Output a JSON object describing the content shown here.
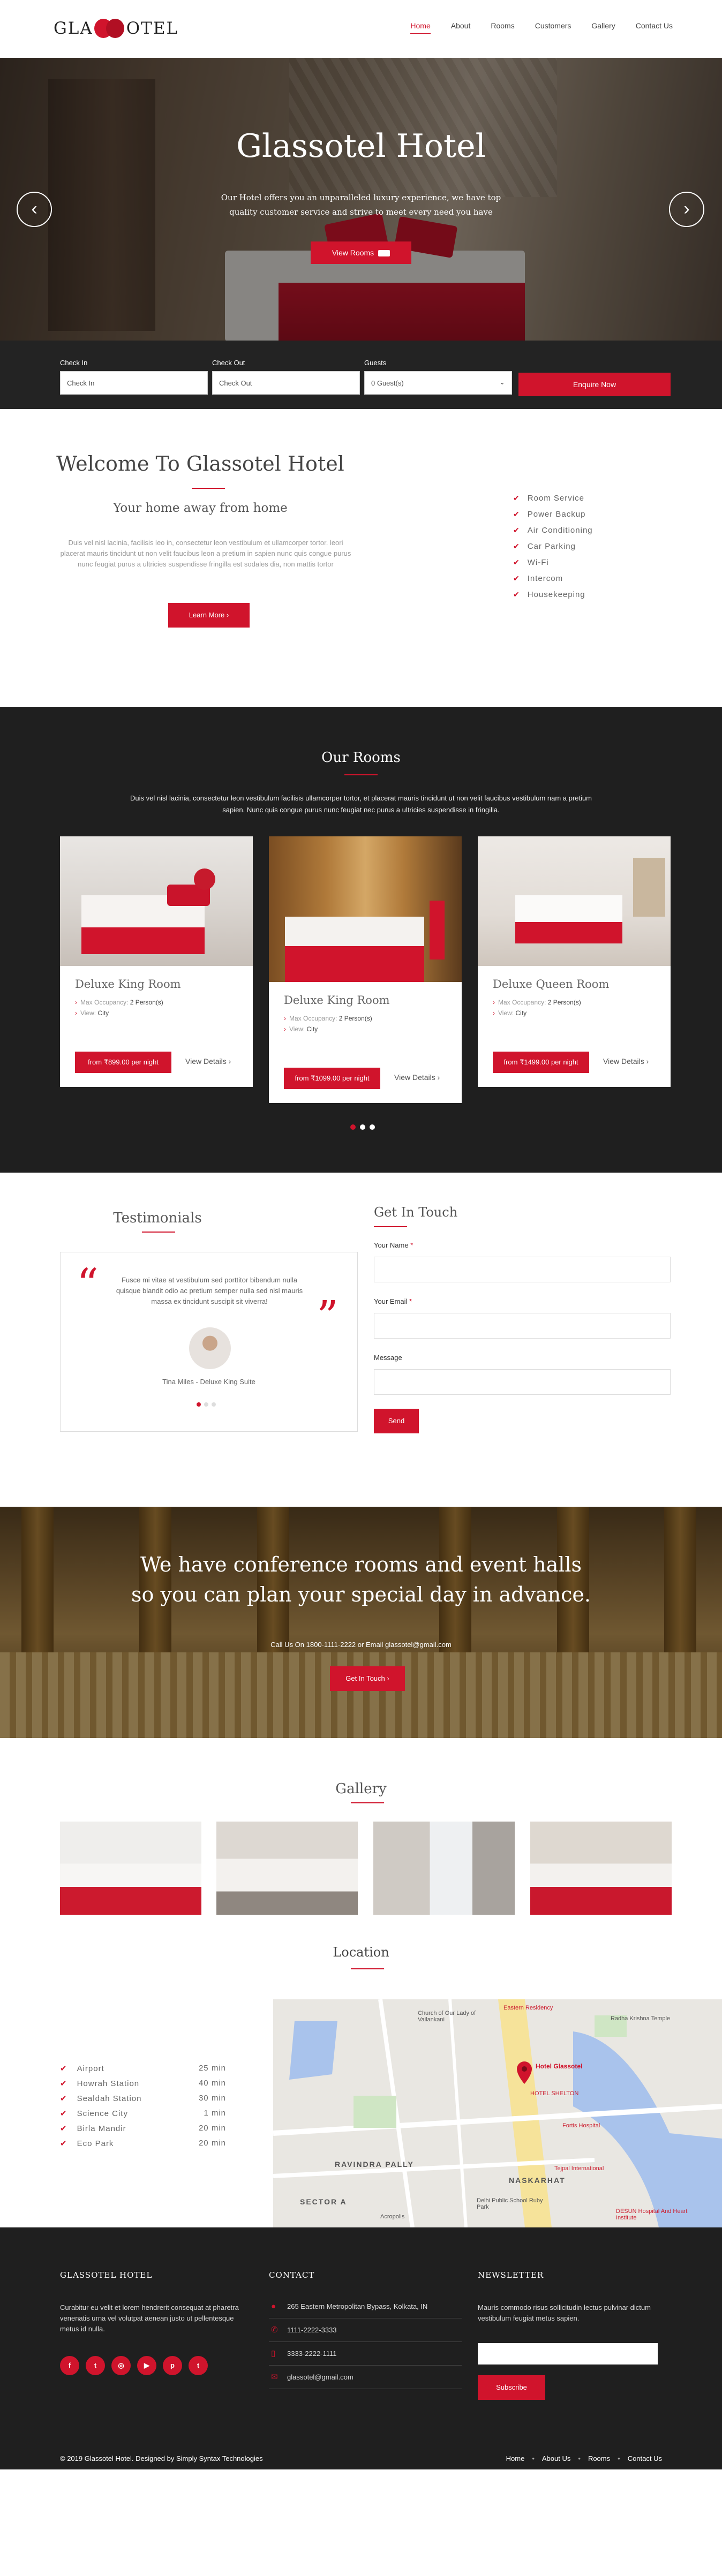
{
  "brand": {
    "logo_text_left": "GLA",
    "logo_text_right": "OTEL"
  },
  "nav": {
    "items": [
      "Home",
      "About",
      "Rooms",
      "Customers",
      "Gallery",
      "Contact Us"
    ],
    "active": "Home"
  },
  "hero": {
    "title": "Glassotel Hotel",
    "text": "Our Hotel offers you an unparalleled luxury experience, we have top quality customer service and strive to meet every need you have",
    "button": "View Rooms",
    "prev": "‹",
    "next": "›"
  },
  "booking": {
    "checkin_label": "Check In",
    "checkin_placeholder": "Check In",
    "checkout_label": "Check Out",
    "checkout_placeholder": "Check Out",
    "guests_label": "Guests",
    "guests_value": "0 Guest(s)",
    "button": "Enquire Now"
  },
  "welcome": {
    "title": "Welcome To Glassotel Hotel",
    "subtitle": "Your home away from home",
    "text": "Duis vel nisl lacinia, facilisis leo in, consectetur leon vestibulum et ullamcorper tortor. leori placerat mauris tincidunt ut non velit faucibus leon a pretium in sapien nunc quis congue purus nunc feugiat purus a ultricies suspendisse fringilla est sodales dia, non mattis tortor",
    "button": "Learn More",
    "amenities": [
      "Room Service",
      "Power Backup",
      "Air Conditioning",
      "Car Parking",
      "Wi-Fi",
      "Intercom",
      "Housekeeping"
    ]
  },
  "rooms": {
    "title": "Our Rooms",
    "text": "Duis vel nisl lacinia, consectetur leon vestibulum facilisis ullamcorper tortor, et placerat mauris tincidunt ut non velit faucibus vestibulum nam a pretium sapien. Nunc quis congue purus nunc feugiat nec purus a ultricies suspendisse in fringilla.",
    "occupancy_label": "Max Occupancy:",
    "view_label": "View:",
    "details_label": "View Details",
    "items": [
      {
        "name": "Deluxe King Room",
        "occupancy": "2 Person(s)",
        "view": "City",
        "price": "from ₹899.00 per night"
      },
      {
        "name": "Deluxe King Room",
        "occupancy": "2 Person(s)",
        "view": "City",
        "price": "from ₹1099.00 per night"
      },
      {
        "name": "Deluxe Queen Room",
        "occupancy": "2 Person(s)",
        "view": "City",
        "price": "from ₹1499.00 per night"
      }
    ]
  },
  "testimonials": {
    "title": "Testimonials",
    "quote": "Fusce mi vitae at vestibulum sed porttitor bibendum nulla quisque blandit odio ac pretium semper nulla sed nisl mauris massa ex tincidunt suscipit sit viverra!",
    "author": "Tina Miles - Deluxe King Suite"
  },
  "contact_form": {
    "title": "Get In Touch",
    "name_label": "Your Name",
    "email_label": "Your Email",
    "message_label": "Message",
    "required_mark": "*",
    "button": "Send"
  },
  "events": {
    "title": "We have conference rooms and event halls so you can plan your special day in advance.",
    "call_text": "Call Us On 1800-1111-2222 or Email glassotel@gmail.com",
    "button": "Get In Touch"
  },
  "gallery": {
    "title": "Gallery"
  },
  "location": {
    "title": "Location",
    "places": [
      {
        "name": "Airport",
        "time": "25 min"
      },
      {
        "name": "Howrah Station",
        "time": "40 min"
      },
      {
        "name": "Sealdah Station",
        "time": "30 min"
      },
      {
        "name": "Science City",
        "time": "1 min"
      },
      {
        "name": "Birla Mandir",
        "time": "20 min"
      },
      {
        "name": "Eco Park",
        "time": "20 min"
      }
    ],
    "map_labels": {
      "pin": "Hotel Glassotel",
      "residency": "Eastern Residency",
      "church": "Church of Our Lady of Vailankani",
      "radha": "Radha Krishna Temple",
      "shelton": "HOTEL SHELTON",
      "fortis": "Fortis Hospital",
      "area1": "RAVINDRA PALLY",
      "area2": "NASKARHAT",
      "area3": "SECTOR A",
      "school": "Delhi Public School Ruby Park",
      "acropolis": "Acropolis",
      "desun": "DESUN Hospital And Heart Institute",
      "intl": "Tejpal International"
    }
  },
  "footer": {
    "about_title": "GLASSOTEL HOTEL",
    "about_text": "Curabitur eu velit et lorem hendrerit consequat at pharetra venenatis urna vel volutpat aenean justo ut pellentesque metus id nulla.",
    "social": [
      "f",
      "t",
      "◎",
      "▶",
      "p",
      "t"
    ],
    "contact_title": "CONTACT",
    "address": "265 Eastern Metropolitan Bypass, Kolkata, IN",
    "phone1": "1111-2222-3333",
    "phone2": "3333-2222-1111",
    "email": "glassotel@gmail.com",
    "newsletter_title": "NEWSLETTER",
    "newsletter_text": "Mauris commodo risus sollicitudin lectus pulvinar dictum vestibulum feugiat metus sapien.",
    "subscribe": "Subscribe",
    "copyright": "© 2019 Glassotel Hotel. Designed by Simply Syntax Technologies",
    "links": [
      "Home",
      "About Us",
      "Rooms",
      "Contact Us"
    ]
  },
  "colors": {
    "accent": "#d0142c",
    "dark": "#1f1f1f"
  }
}
